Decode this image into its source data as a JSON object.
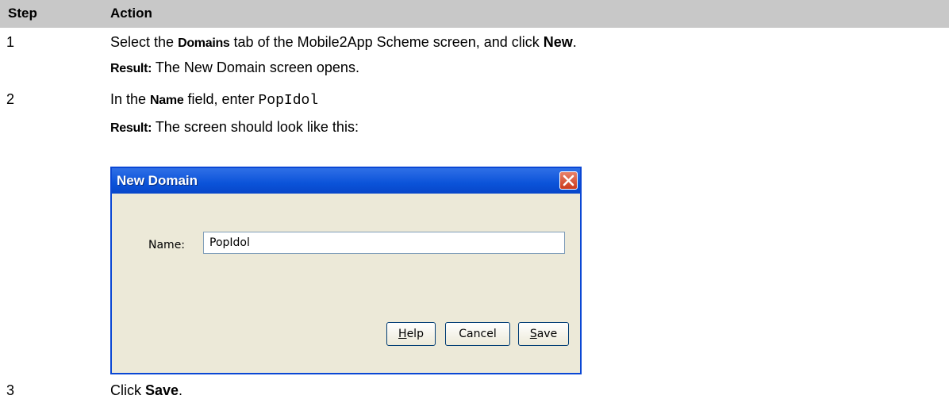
{
  "header": {
    "col1": "Step",
    "col2": "Action"
  },
  "steps": [
    {
      "number": "1",
      "action": {
        "pre": "Select the ",
        "bold": "Domains",
        "mid": " tab of the Mobile2App Scheme screen, and click ",
        "bold2": "New",
        "post": "."
      },
      "result": {
        "label": "Result:",
        "text": " The New Domain screen opens."
      }
    },
    {
      "number": "2",
      "action": {
        "pre": "In the ",
        "bold": "Name",
        "mid": " field, enter ",
        "code": "PopIdol"
      },
      "result": {
        "label": "Result:",
        "text": " The screen should look like this:"
      }
    },
    {
      "number": "3",
      "action": {
        "pre": "Click ",
        "bold": "Save",
        "post": "."
      }
    }
  ],
  "dialog": {
    "title": "New Domain",
    "name_label": "Name:",
    "name_value": "PopIdol",
    "help_first": "H",
    "help_rest": "elp",
    "cancel": "Cancel",
    "save_first": "S",
    "save_rest": "ave",
    "close_icon": "close-x-icon",
    "title_color": "#0b53d9"
  }
}
